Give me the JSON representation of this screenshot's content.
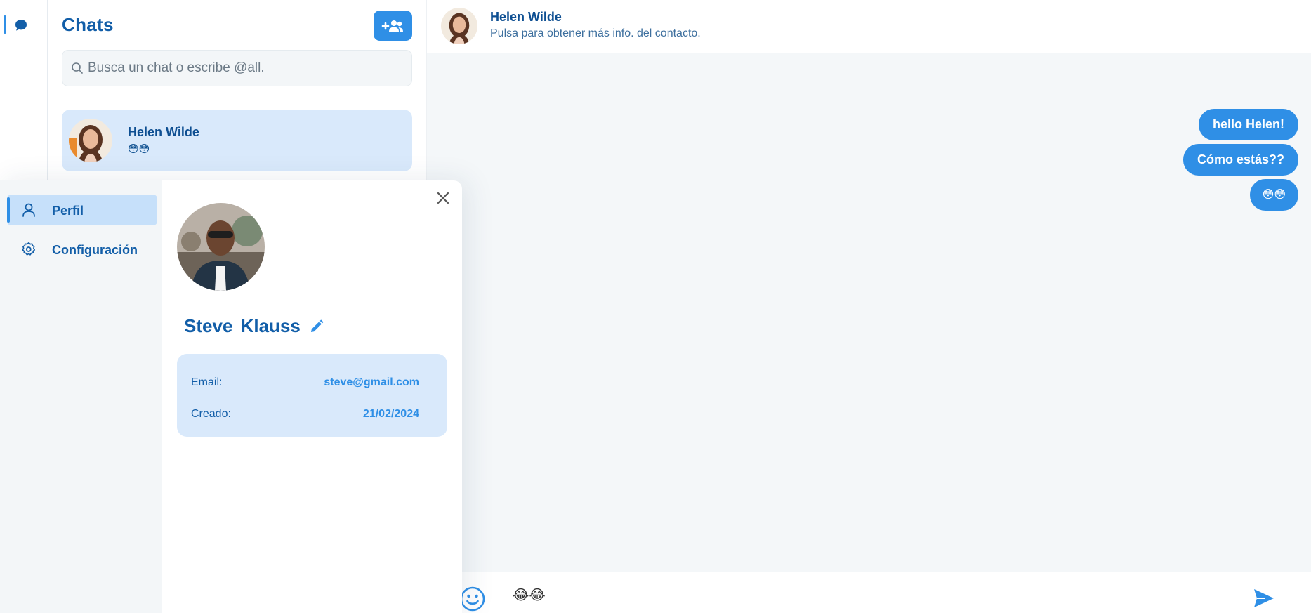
{
  "colors": {
    "accent": "#2f8fe6",
    "primary_text": "#125ea8",
    "highlight_bg": "#d9e9fb",
    "panel_bg": "#f3f6f8"
  },
  "rail": {
    "items": [
      {
        "icon": "chat-bubble-icon",
        "active": true
      }
    ]
  },
  "chat_list": {
    "title": "Chats",
    "new_chat_icon": "add-group-icon",
    "search": {
      "placeholder": "Busca un chat o escribe @all.",
      "value": ""
    },
    "contacts": [
      {
        "name": "Helen Wilde",
        "preview": "😳😳",
        "avatar": "helen-avatar"
      }
    ]
  },
  "conversation": {
    "contact_name": "Helen Wilde",
    "contact_subtitle": "Pulsa para obtener más info. del contacto.",
    "messages": [
      {
        "text": "hello Helen!",
        "sender": "me"
      },
      {
        "text": "Cómo estás??",
        "sender": "me"
      },
      {
        "text": "😳😳",
        "sender": "me"
      }
    ],
    "composer": {
      "value": "😂😂",
      "emoji_icon": "smiley-icon",
      "send_icon": "send-icon"
    }
  },
  "profile_panel": {
    "nav": [
      {
        "label": "Perfil",
        "icon": "user-icon",
        "active": true
      },
      {
        "label": "Configuración",
        "icon": "gear-icon",
        "active": false
      }
    ],
    "name": "Steve Klauss",
    "fields": [
      {
        "label": "Email:",
        "value": "steve@gmail.com"
      },
      {
        "label": "Creado:",
        "value": "21/02/2024"
      }
    ]
  }
}
